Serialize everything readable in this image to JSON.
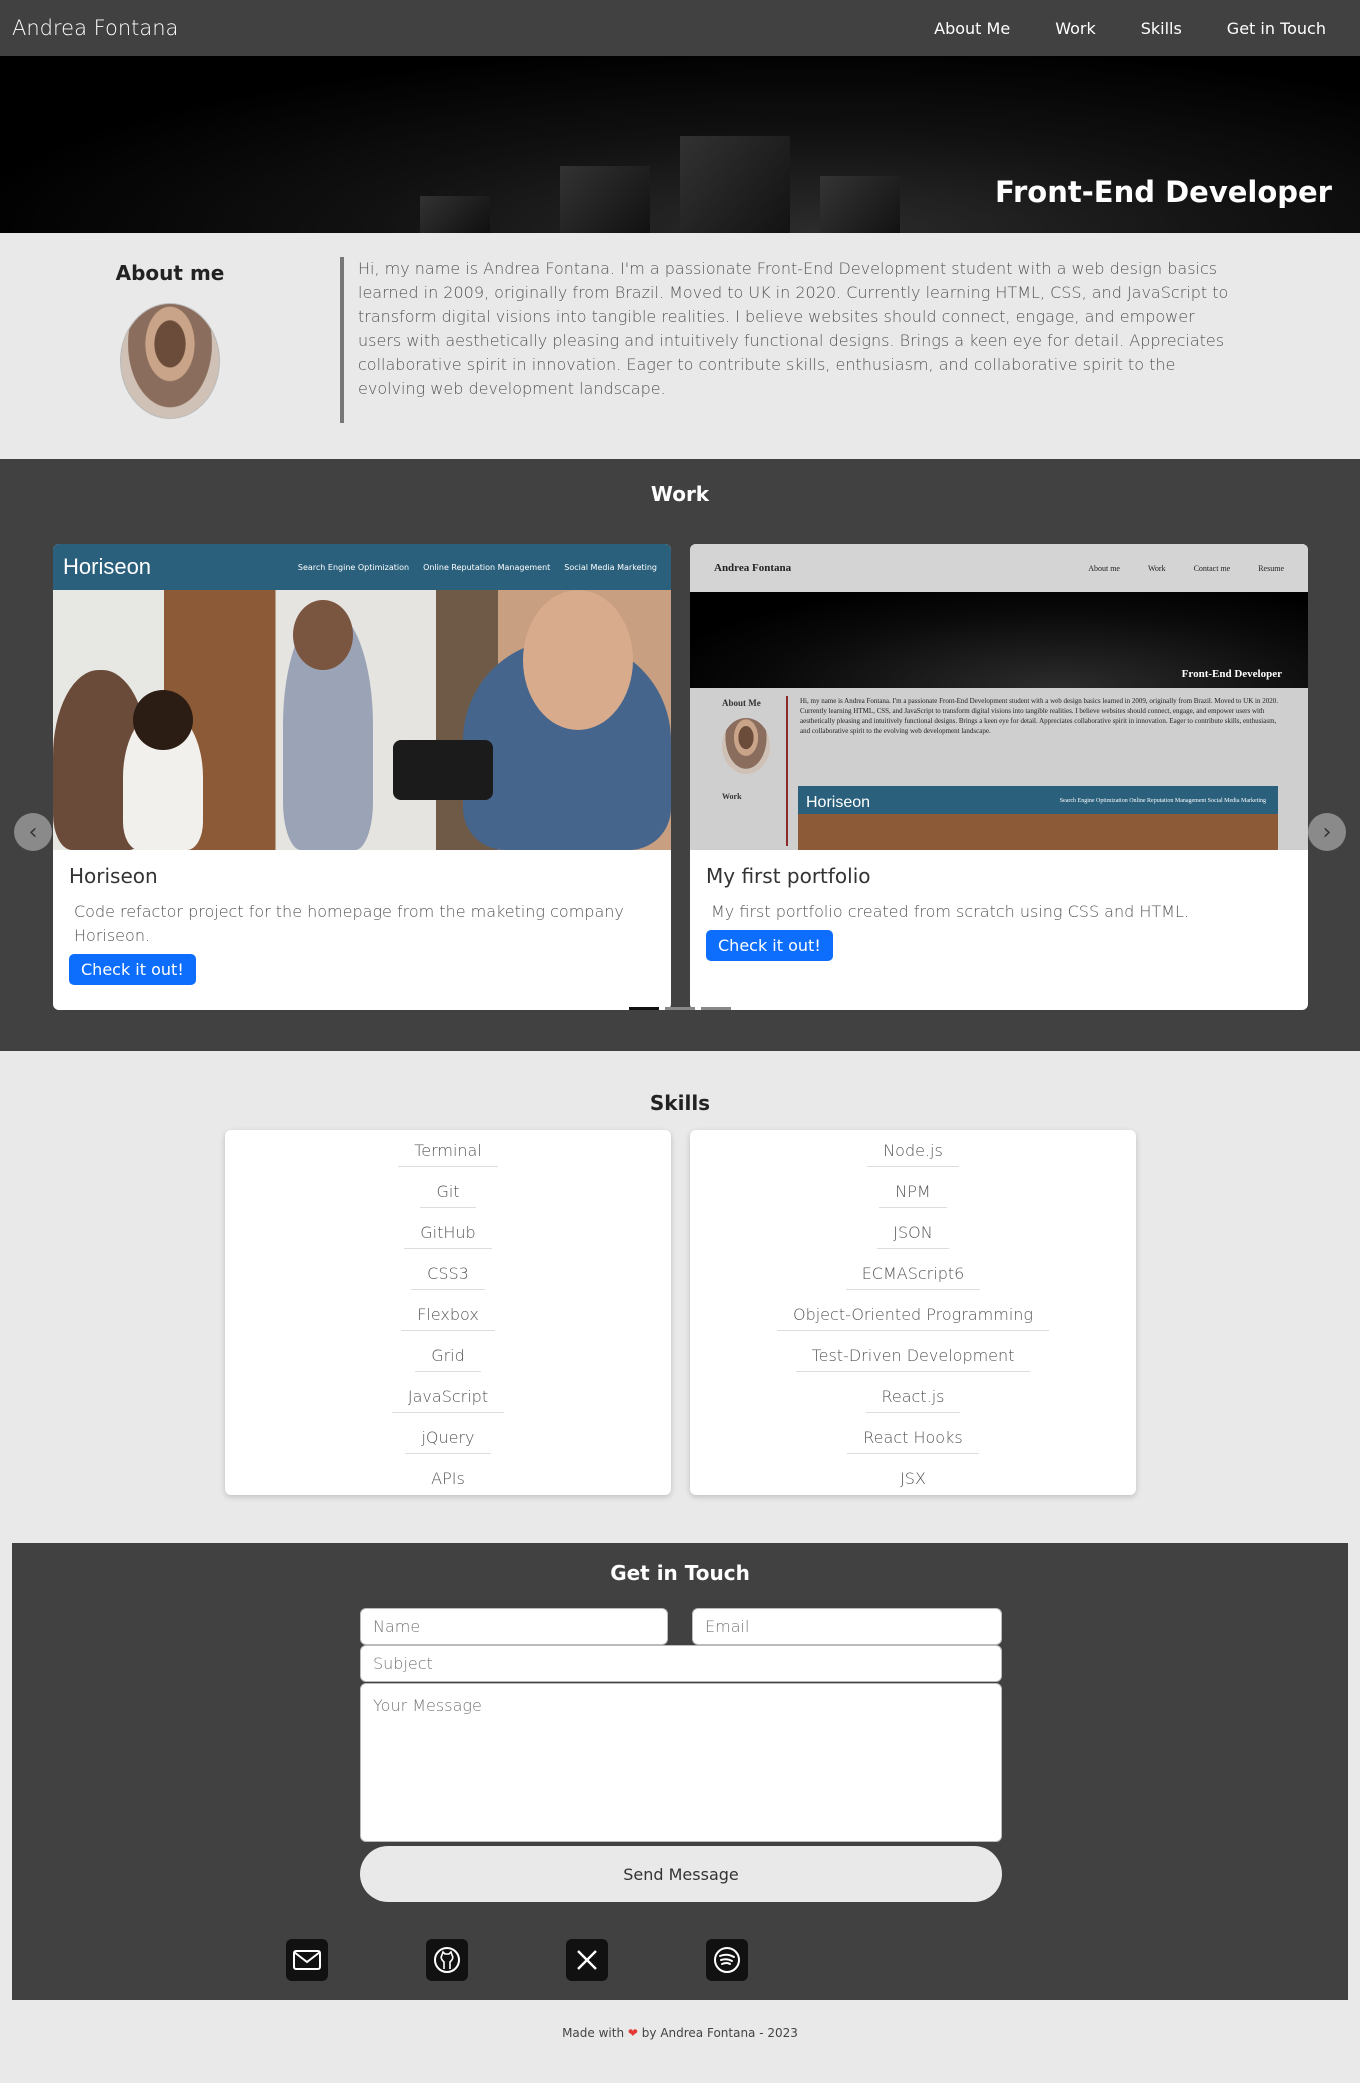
{
  "nav": {
    "brand": "Andrea Fontana",
    "links": [
      "About Me",
      "Work",
      "Skills",
      "Get in Touch"
    ]
  },
  "hero": {
    "title": "Front-End Developer"
  },
  "about": {
    "heading": "About me",
    "text": "Hi, my name is Andrea Fontana. I'm a passionate Front-End Development student with a web design basics learned in 2009, originally from Brazil. Moved to UK in 2020. Currently learning HTML, CSS, and JavaScript to transform digital visions into tangible realities. I believe websites should connect, engage, and empower users with aesthetically pleasing and intuitively functional designs. Brings a keen eye for detail. Appreciates collaborative spirit in innovation. Eager to contribute skills, enthusiasm, and collaborative spirit to the evolving web development landscape."
  },
  "work": {
    "heading": "Work",
    "cards": [
      {
        "title": "Horiseon",
        "description": "Code refactor project for the homepage from the maketing company Horiseon.",
        "button": "Check it out!",
        "preview": {
          "logo": "Horiseon",
          "links": [
            "Search Engine Optimization",
            "Online Reputation Management",
            "Social Media Marketing"
          ]
        }
      },
      {
        "title": "My first portfolio",
        "description": "My first portfolio created from scratch using CSS and HTML.",
        "button": "Check it out!",
        "preview": {
          "brand": "Andrea Fontana",
          "links": [
            "About me",
            "Work",
            "Contact me",
            "Resume"
          ],
          "hero": "Front-End Developer",
          "about_heading": "About Me",
          "about_text": "Hi, my name is Andrea Fontana. I'm a passionate Front-End Development student with a web design basics learned in 2009, originally from Brazil. Moved to UK in 2020. Currently learning HTML, CSS, and JavaScript to transform digital visions into tangible realities. I believe websites should connect, engage, and empower users with aesthetically pleasing and intuitively functional designs. Brings a keen eye for detail. Appreciates collaborative spirit in innovation. Eager to contribute skills, enthusiasm, and collaborative spirit to the evolving web development landscape.",
          "work_heading": "Work",
          "horiseon_logo": "Horiseon",
          "horiseon_links": "Search Engine Optimization    Online Reputation Management    Social Media Marketing"
        }
      }
    ],
    "prev_icon": "chevron-left-icon",
    "next_icon": "chevron-right-icon"
  },
  "skills": {
    "heading": "Skills",
    "left": [
      "Terminal",
      "Git",
      "GitHub",
      "CSS3",
      "Flexbox",
      "Grid",
      "JavaScript",
      "jQuery",
      "APIs"
    ],
    "right": [
      "Node.js",
      "NPM",
      "JSON",
      "ECMAScript6",
      "Object-Oriented Programming",
      "Test-Driven Development",
      "React.js",
      "React Hooks",
      "JSX"
    ]
  },
  "contact": {
    "heading": "Get in Touch",
    "name_placeholder": "Name",
    "email_placeholder": "Email",
    "subject_placeholder": "Subject",
    "message_placeholder": "Your Message",
    "send_label": "Send Message",
    "socials": [
      "envelope-icon",
      "github-icon",
      "x-icon",
      "spotify-icon"
    ]
  },
  "footer": {
    "prefix": "Made with",
    "suffix": "by Andrea Fontana - 2023"
  },
  "colors": {
    "dark": "#414141",
    "light": "#e9e9e9",
    "accent": "#0d6efd",
    "horiseon": "#2a607c"
  }
}
